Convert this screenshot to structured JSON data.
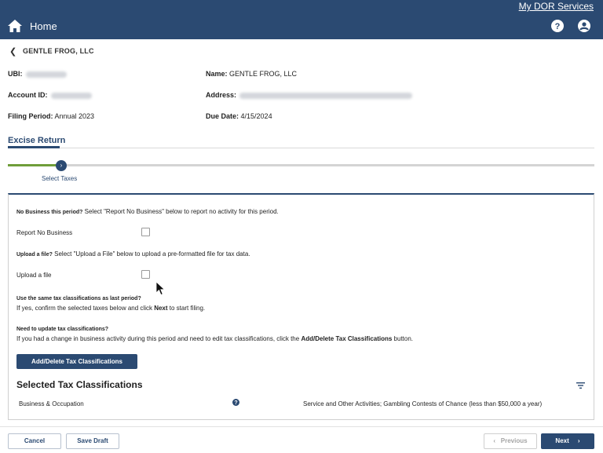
{
  "header": {
    "my_dor_services": "My DOR Services",
    "home_label": "Home"
  },
  "entity": {
    "name": "GENTLE FROG, LLC"
  },
  "details": {
    "ubi_label": "UBI:",
    "account_id_label": "Account ID:",
    "filing_period_label": "Filing Period:",
    "filing_period_value": "Annual 2023",
    "name_label": "Name:",
    "name_value": "GENTLE FROG, LLC",
    "address_label": "Address:",
    "due_date_label": "Due Date:",
    "due_date_value": "4/15/2024"
  },
  "tabs": {
    "active": "Excise Return"
  },
  "progress": {
    "step_label": "Select Taxes",
    "step_icon": "chevron-right-icon"
  },
  "form": {
    "no_business_q": "No Business this period?",
    "no_business_text": " Select \"Report No Business\" below to report no activity for this period.",
    "report_no_business_label": "Report No Business",
    "upload_q": "Upload a file?",
    "upload_text": " Select \"Upload a File\" below to upload a pre-formatted file for tax data.",
    "upload_label": "Upload a file",
    "same_tax_q": "Use the same tax classifications as last period?",
    "same_tax_text_1": "If yes, confirm the selected taxes below and click ",
    "same_tax_next": "Next",
    "same_tax_text_2": " to start filing.",
    "update_q": "Need to update tax classifications?",
    "update_text_1": "If you had a change in business activity during this period and need to edit tax classifications, click the ",
    "update_bold": "Add/Delete Tax Classifications",
    "update_text_2": " button.",
    "add_delete_button": "Add/Delete Tax Classifications"
  },
  "selected": {
    "title": "Selected Tax Classifications",
    "rows": [
      {
        "classification": "Business & Occupation",
        "description": "Service and Other Activities; Gambling Contests of Chance (less than $50,000 a year)"
      }
    ]
  },
  "footer": {
    "cancel": "Cancel",
    "save_draft": "Save Draft",
    "previous": "Previous",
    "next": "Next"
  },
  "colors": {
    "brand": "#2b4a72",
    "progress_green": "#6f9e3a"
  }
}
